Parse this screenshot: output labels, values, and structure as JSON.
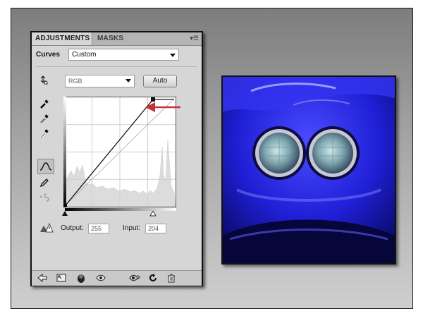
{
  "tabs": [
    {
      "label": "ADJUSTMENTS",
      "active": true
    },
    {
      "label": "MASKS",
      "active": false
    }
  ],
  "panel_menu_icon": "panel-menu-icon",
  "adjustment": {
    "name": "Curves",
    "preset": "Custom",
    "channel": "RGB",
    "auto_label": "Auto"
  },
  "curve": {
    "output_label": "Output:",
    "output_value": "255",
    "input_label": "Input:",
    "input_value": "204"
  },
  "left_tools": [
    "on-image-adjust-icon",
    "black-point-eyedropper-icon",
    "gray-point-eyedropper-icon",
    "white-point-eyedropper-icon",
    "curve-points-icon",
    "pencil-draw-icon",
    "smooth-icon"
  ],
  "bottom_icons": [
    "back-arrow-icon",
    "expanded-view-icon",
    "clip-to-layer-icon",
    "visibility-eye-icon",
    "view-previous-icon",
    "reset-icon",
    "trash-icon"
  ],
  "colors": {
    "annotation_arrow": "#c8303a",
    "photo_blue": "#1a1ad0"
  }
}
